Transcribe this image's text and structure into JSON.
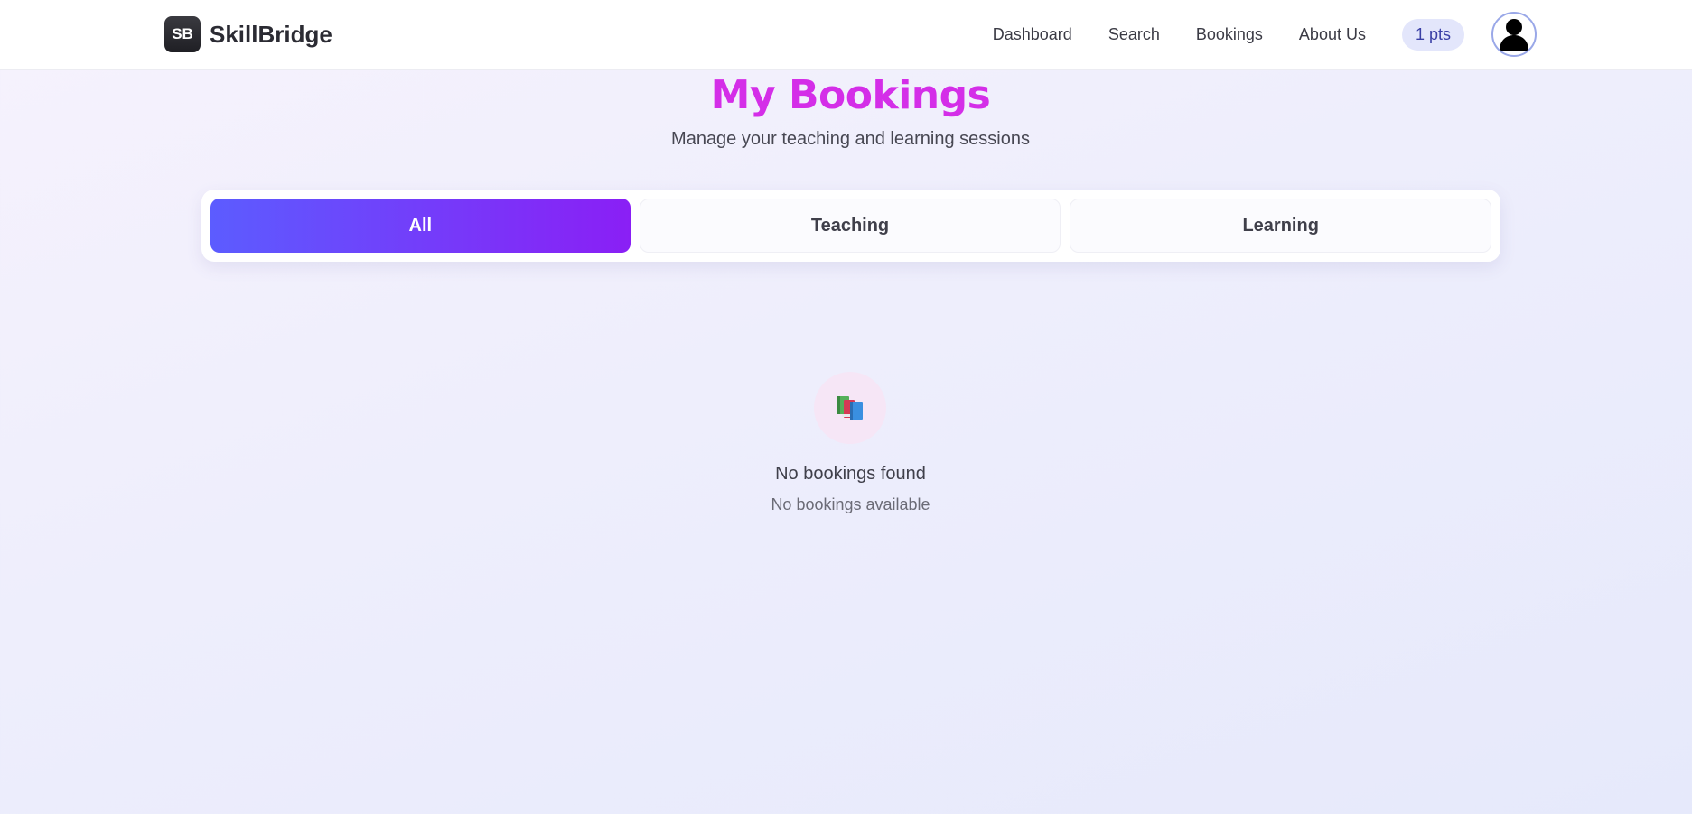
{
  "brand": {
    "logo_text": "SB",
    "name": "SkillBridge"
  },
  "nav": {
    "links": [
      "Dashboard",
      "Search",
      "Bookings",
      "About Us"
    ],
    "points": "1 pts",
    "avatar_icon": "user-avatar-icon"
  },
  "page": {
    "title": "My Bookings",
    "subtitle": "Manage your teaching and learning sessions"
  },
  "tabs": [
    {
      "label": "All",
      "active": true
    },
    {
      "label": "Teaching",
      "active": false
    },
    {
      "label": "Learning",
      "active": false
    }
  ],
  "empty_state": {
    "icon": "books-icon",
    "title": "No bookings found",
    "subtitle": "No bookings available"
  },
  "colors": {
    "title": "#d42ee8",
    "tab_active_start": "#5c5cff",
    "tab_active_end": "#8a1ff5",
    "points_bg": "#e3e6fb"
  }
}
